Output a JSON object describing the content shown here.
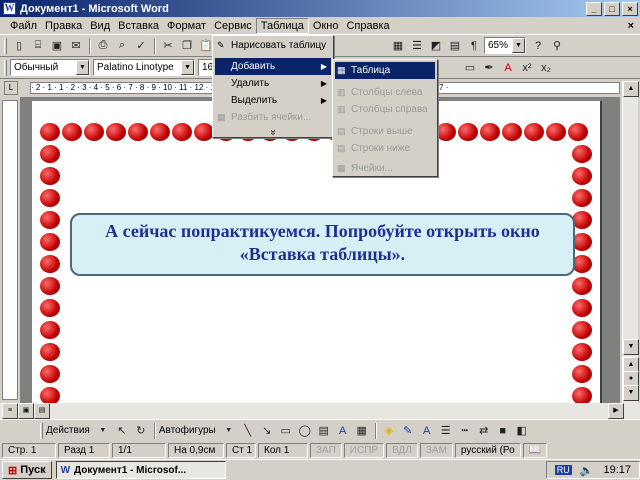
{
  "window": {
    "title": "Документ1 - Microsoft Word",
    "buttons": [
      "_",
      "□",
      "×"
    ]
  },
  "menubar": {
    "items": [
      "Файл",
      "Правка",
      "Вид",
      "Вставка",
      "Формат",
      "Сервис",
      "Таблица",
      "Окно",
      "Справка"
    ],
    "active_index": 6,
    "close_doc": "×"
  },
  "toolbar_standard": {
    "draw_table_label": "Нарисовать таблицу",
    "zoom_value": "65%"
  },
  "toolbar_format": {
    "style_value": "Обычный",
    "font_value": "Palatino Linotype",
    "size_value": "16"
  },
  "ruler": {
    "ticks": "· 2 · 1 · 1 · 2 · 3 · 4 · 5 · 6 · 7 · 8 · 9 · 10 · 11 · 12 · 13 · 14 · 15 · 16 · 17 · 18 · 19 · 20 · 21 · 22 · 23 · 24 · 25 · 26 · 27 ·"
  },
  "table_menu": {
    "items": [
      {
        "label": "Добавить",
        "state": "selected",
        "submenu": true
      },
      {
        "label": "Удалить",
        "state": "normal",
        "submenu": true
      },
      {
        "label": "Выделить",
        "state": "normal",
        "submenu": true
      },
      {
        "label": "Разбить ячейки...",
        "state": "disabled",
        "submenu": false
      }
    ],
    "more": "»"
  },
  "add_submenu": {
    "items": [
      {
        "label": "Таблица",
        "state": "selected"
      },
      {
        "label": "Столбцы слева",
        "state": "disabled"
      },
      {
        "label": "Столбцы справа",
        "state": "disabled"
      },
      {
        "label": "Строки выше",
        "state": "disabled"
      },
      {
        "label": "Строки ниже",
        "state": "disabled"
      },
      {
        "label": "Ячейки...",
        "state": "disabled"
      }
    ]
  },
  "callout": {
    "text": "А сейчас попрактикуемся. Попробуйте открыть окно «Вставка таблицы»."
  },
  "drawing_toolbar": {
    "actions_label": "Действия",
    "autoshapes_label": "Автофигуры"
  },
  "statusbar": {
    "page": "Стр. 1",
    "section": "Разд 1",
    "pages": "1/1",
    "at": "На 0,9см",
    "line": "Ст 1",
    "col": "Кол 1",
    "rec": "ЗАП",
    "trk": "ИСПР",
    "ext": "ВДЛ",
    "ovr": "ЗАМ",
    "language": "русский (Ро"
  },
  "taskbar": {
    "start_label": "Пуск",
    "task_label": "Документ1 - Microsof...",
    "lang_indicator": "RU",
    "clock": "19:17"
  },
  "colors": {
    "title_gradient_start": "#0a246a",
    "callout_bg": "#d7f0f6",
    "callout_text": "#1f2f8f",
    "apple_red": "#c00000"
  }
}
